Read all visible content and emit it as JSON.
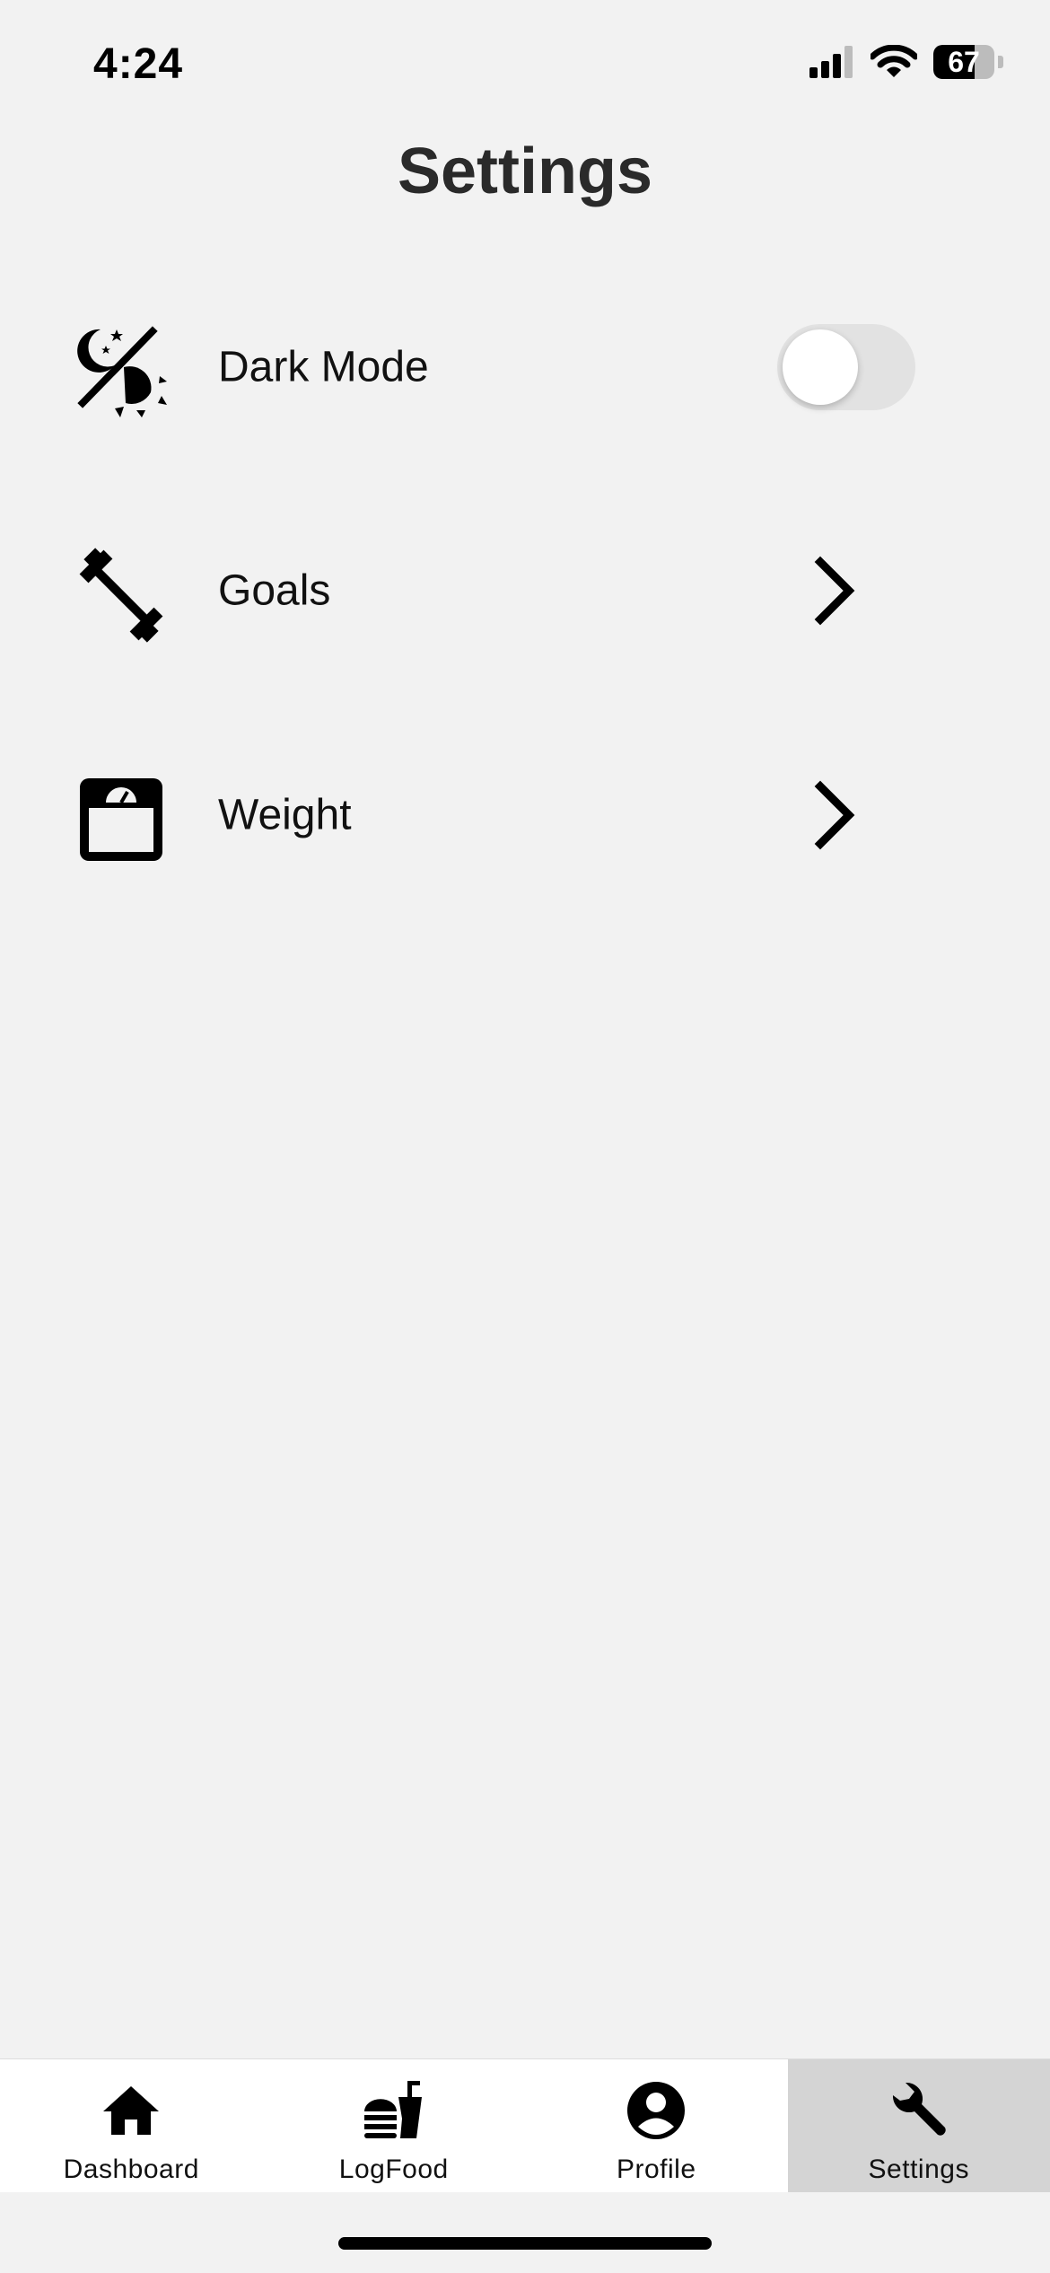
{
  "status_bar": {
    "time": "4:24",
    "battery_percent": 67,
    "battery_label": "67",
    "signal_bars_active": 3,
    "icons": [
      "cellular-signal-icon",
      "wifi-icon",
      "battery-icon"
    ]
  },
  "page": {
    "title": "Settings"
  },
  "settings": {
    "items": [
      {
        "label": "Dark Mode",
        "icon": "dark-mode-icon",
        "control": "toggle",
        "enabled": false
      },
      {
        "label": "Goals",
        "icon": "barbell-icon",
        "control": "chevron"
      },
      {
        "label": "Weight",
        "icon": "scale-icon",
        "control": "chevron"
      }
    ]
  },
  "tab_bar": {
    "active_tab": "Settings",
    "tabs": [
      {
        "label": "Dashboard",
        "icon": "home-icon"
      },
      {
        "label": "LogFood",
        "icon": "fast-food-icon"
      },
      {
        "label": "Profile",
        "icon": "account-circle-icon"
      },
      {
        "label": "Settings",
        "icon": "wrench-icon"
      }
    ]
  },
  "colors": {
    "background": "#f2f2f2",
    "tab_bar_background": "#ffffff",
    "active_tab_background": "#d4d4d4",
    "toggle_off": "#e2e2e2",
    "text": "#111111"
  }
}
